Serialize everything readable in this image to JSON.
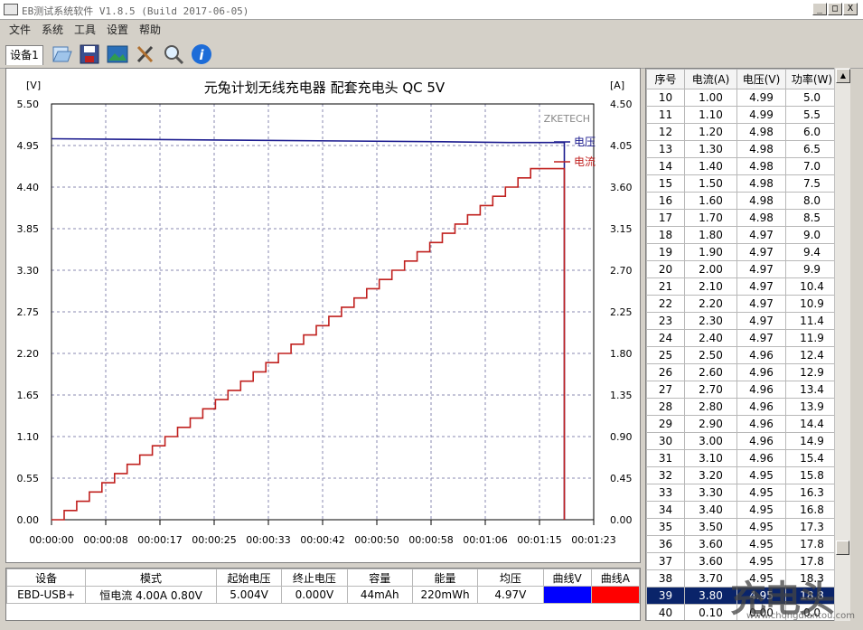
{
  "window": {
    "title": "EB测试系统软件 V1.8.5 (Build 2017-06-05)",
    "minimize": "_",
    "maximize": "□",
    "close": "X"
  },
  "menu": [
    "文件",
    "系统",
    "工具",
    "设置",
    "帮助"
  ],
  "tab": {
    "label": "设备1"
  },
  "toolbar": [
    "open-icon",
    "save-icon",
    "image-icon",
    "tools-icon",
    "search-icon",
    "info-icon"
  ],
  "colors": {
    "voltage": "#1c1c8f",
    "current": "#c0201e",
    "selected_row": "#0a246a"
  },
  "chart_data": {
    "type": "line",
    "title": "元兔计划无线充电器 配套充电头 QC 5V",
    "left_unit": "[V]",
    "right_unit": "[A]",
    "watermark": "ZKETECH",
    "y_left_ticks": [
      "5.50",
      "4.95",
      "4.40",
      "3.85",
      "3.30",
      "2.75",
      "2.20",
      "1.65",
      "1.10",
      "0.55",
      "0.00"
    ],
    "y_right_ticks": [
      "4.50",
      "4.05",
      "3.60",
      "3.15",
      "2.70",
      "2.25",
      "1.80",
      "1.35",
      "0.90",
      "0.45",
      "0.00"
    ],
    "x_ticks": [
      "00:00:00",
      "00:00:08",
      "00:00:17",
      "00:00:25",
      "00:00:33",
      "00:00:42",
      "00:00:50",
      "00:00:58",
      "00:01:06",
      "00:01:15",
      "00:01:23"
    ],
    "ylim_left": [
      0,
      5.5
    ],
    "ylim_right": [
      0,
      4.5
    ],
    "xlim": [
      0,
      83
    ],
    "series": [
      {
        "name": "电压",
        "axis": "left",
        "color": "#1c1c8f",
        "x": [
          0,
          15,
          28,
          45,
          60,
          70,
          78,
          78.5,
          78.5
        ],
        "y": [
          5.04,
          5.03,
          5.02,
          5.01,
          5.0,
          4.99,
          4.99,
          4.99,
          0.0
        ]
      },
      {
        "name": "电流",
        "axis": "right",
        "color": "#c0201e",
        "steps": {
          "start_time": 0,
          "step_duration": 1.93,
          "start_value": 0.0,
          "step_value": 0.1,
          "end_value": 3.8,
          "cutoff": 78.5
        }
      }
    ]
  },
  "table": {
    "headers": [
      "序号",
      "电流(A)",
      "电压(V)",
      "功率(W)"
    ],
    "rows": [
      [
        "10",
        "1.00",
        "4.99",
        "5.0"
      ],
      [
        "11",
        "1.10",
        "4.99",
        "5.5"
      ],
      [
        "12",
        "1.20",
        "4.98",
        "6.0"
      ],
      [
        "13",
        "1.30",
        "4.98",
        "6.5"
      ],
      [
        "14",
        "1.40",
        "4.98",
        "7.0"
      ],
      [
        "15",
        "1.50",
        "4.98",
        "7.5"
      ],
      [
        "16",
        "1.60",
        "4.98",
        "8.0"
      ],
      [
        "17",
        "1.70",
        "4.98",
        "8.5"
      ],
      [
        "18",
        "1.80",
        "4.97",
        "9.0"
      ],
      [
        "19",
        "1.90",
        "4.97",
        "9.4"
      ],
      [
        "20",
        "2.00",
        "4.97",
        "9.9"
      ],
      [
        "21",
        "2.10",
        "4.97",
        "10.4"
      ],
      [
        "22",
        "2.20",
        "4.97",
        "10.9"
      ],
      [
        "23",
        "2.30",
        "4.97",
        "11.4"
      ],
      [
        "24",
        "2.40",
        "4.97",
        "11.9"
      ],
      [
        "25",
        "2.50",
        "4.96",
        "12.4"
      ],
      [
        "26",
        "2.60",
        "4.96",
        "12.9"
      ],
      [
        "27",
        "2.70",
        "4.96",
        "13.4"
      ],
      [
        "28",
        "2.80",
        "4.96",
        "13.9"
      ],
      [
        "29",
        "2.90",
        "4.96",
        "14.4"
      ],
      [
        "30",
        "3.00",
        "4.96",
        "14.9"
      ],
      [
        "31",
        "3.10",
        "4.96",
        "15.4"
      ],
      [
        "32",
        "3.20",
        "4.95",
        "15.8"
      ],
      [
        "33",
        "3.30",
        "4.95",
        "16.3"
      ],
      [
        "34",
        "3.40",
        "4.95",
        "16.8"
      ],
      [
        "35",
        "3.50",
        "4.95",
        "17.3"
      ],
      [
        "36",
        "3.60",
        "4.95",
        "17.8"
      ],
      [
        "37",
        "3.60",
        "4.95",
        "17.8"
      ],
      [
        "38",
        "3.70",
        "4.95",
        "18.3"
      ],
      [
        "39",
        "3.80",
        "4.95",
        "18.8"
      ],
      [
        "40",
        "0.10",
        "0.00",
        "0.0"
      ]
    ],
    "selected_row": "39"
  },
  "status": {
    "headers": [
      "设备",
      "模式",
      "起始电压",
      "终止电压",
      "容量",
      "能量",
      "均压",
      "曲线V",
      "曲线A"
    ],
    "values": [
      "EBD-USB+",
      "恒电流  4.00A  0.80V",
      "5.004V",
      "0.000V",
      "44mAh",
      "220mWh",
      "4.97V",
      "",
      ""
    ]
  },
  "watermark": {
    "brand": "充电头",
    "url": "www.chongdiantou.com"
  }
}
